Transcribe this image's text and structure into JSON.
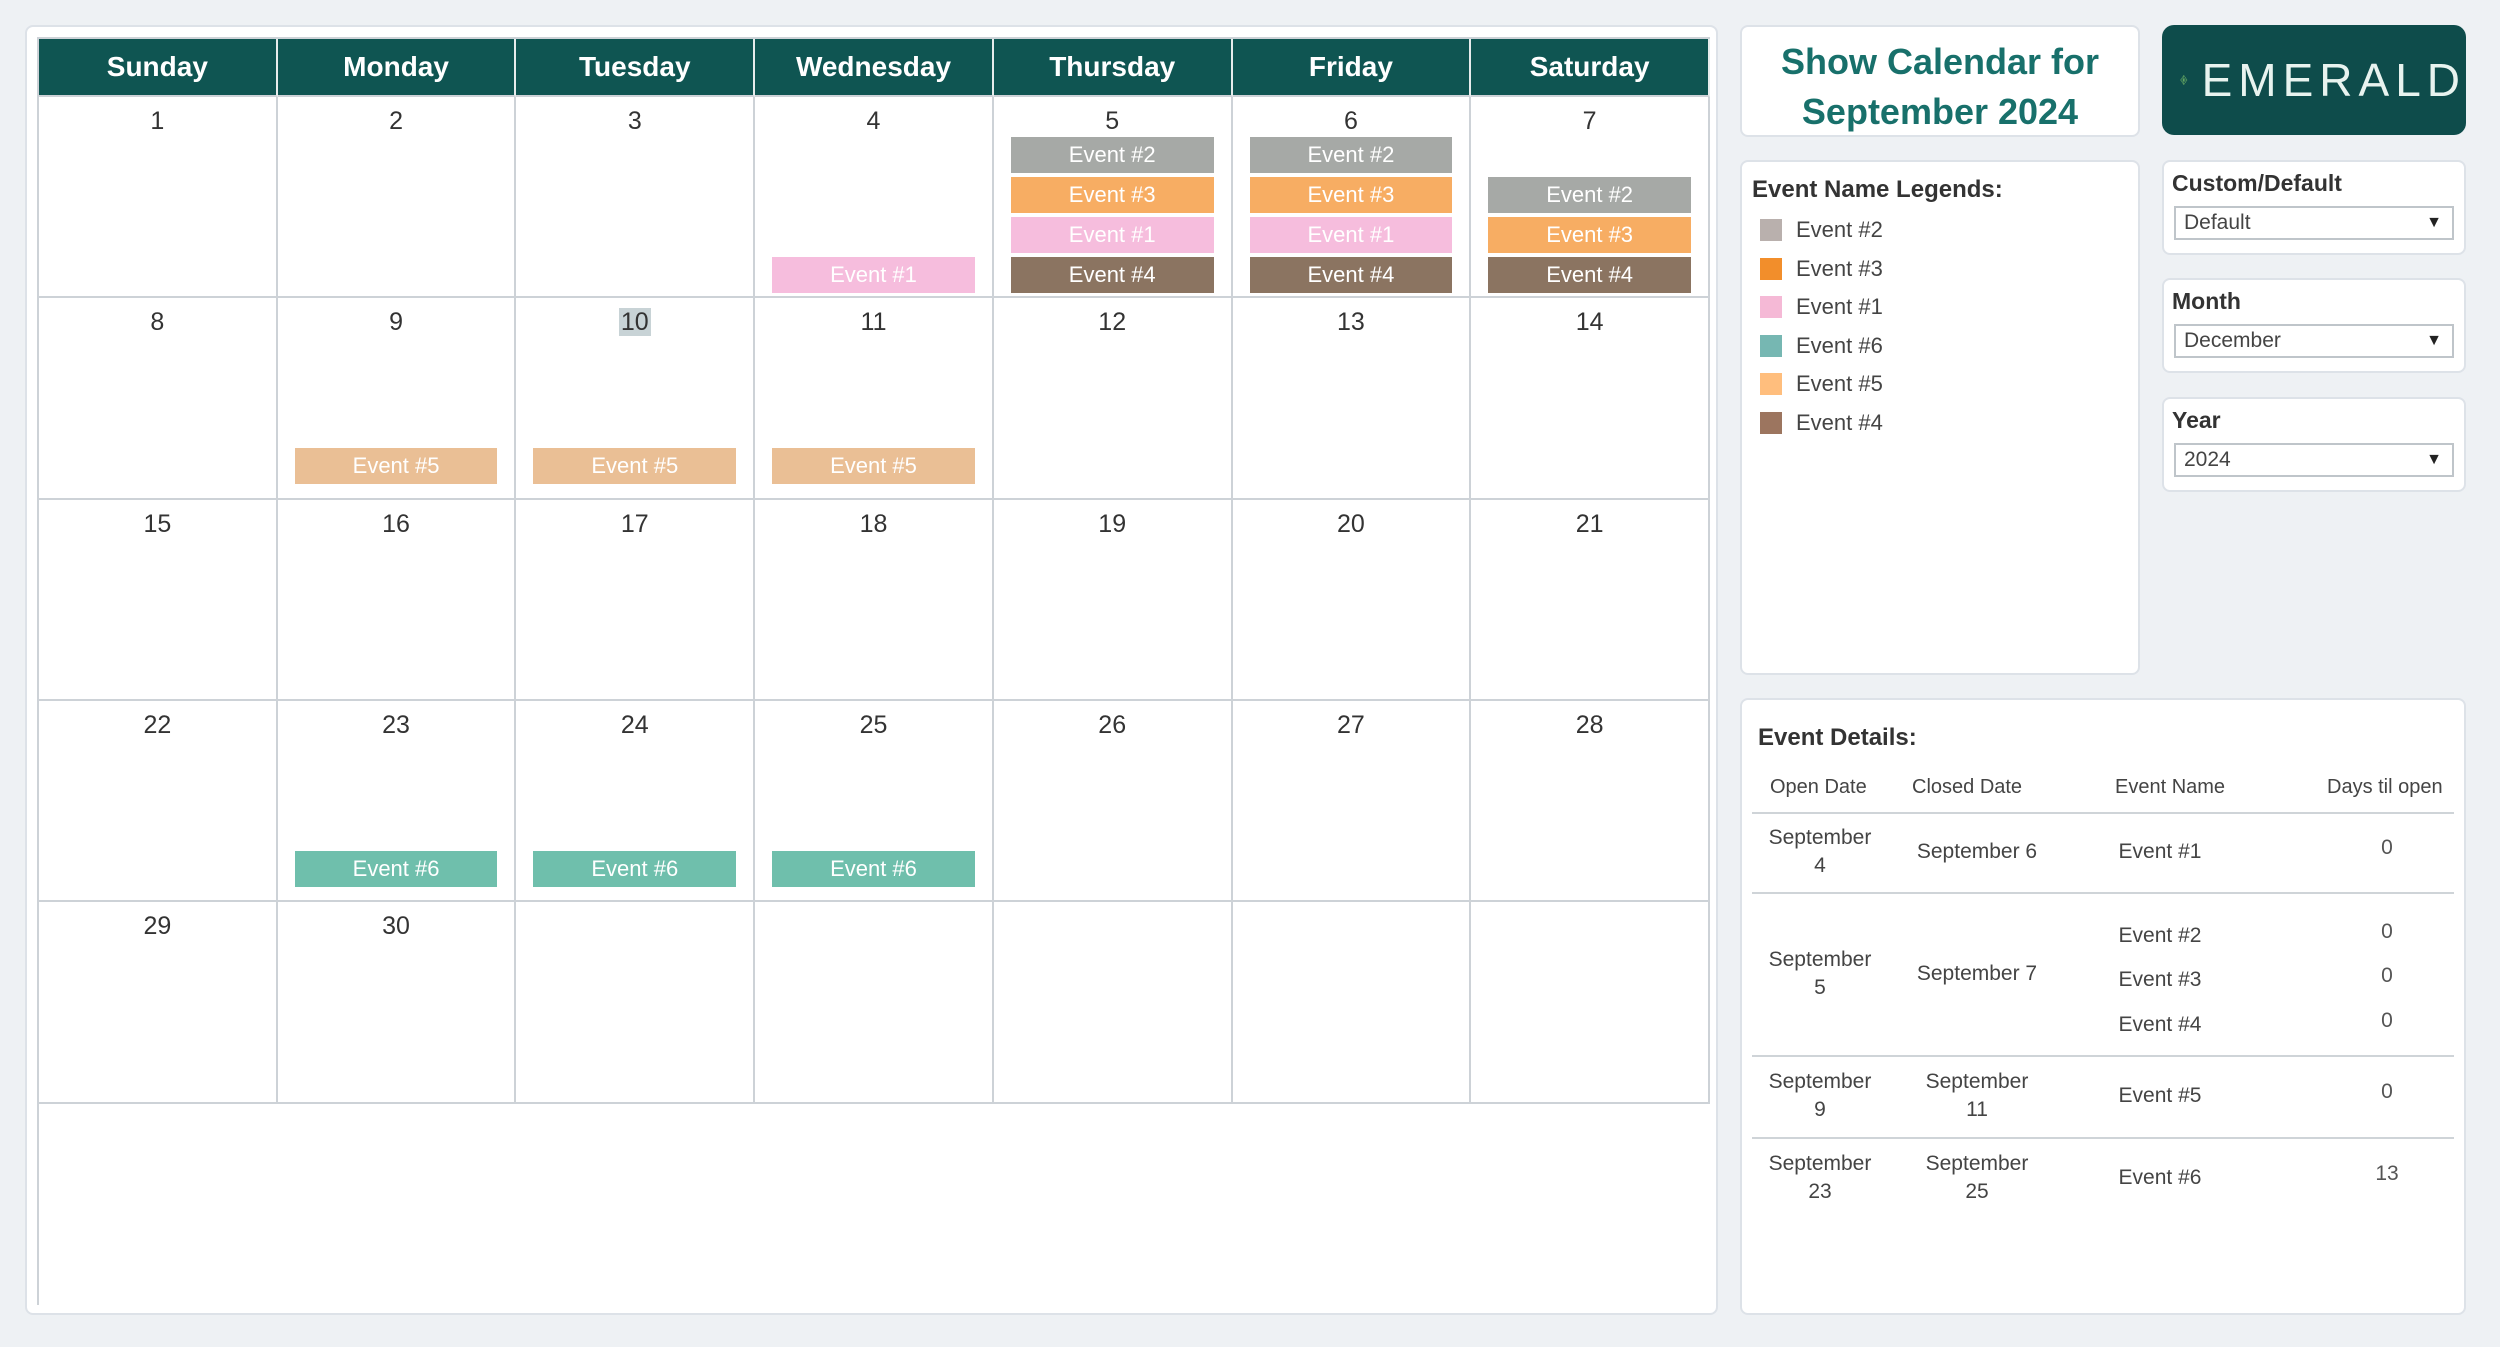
{
  "calendar": {
    "day_names": [
      "Sunday",
      "Monday",
      "Tuesday",
      "Wednesday",
      "Thursday",
      "Friday",
      "Saturday"
    ],
    "weeks": [
      [
        {
          "day": "1",
          "events": []
        },
        {
          "day": "2",
          "events": []
        },
        {
          "day": "3",
          "events": []
        },
        {
          "day": "4",
          "events": [
            {
              "name": "Event #1",
              "slot": 3
            }
          ]
        },
        {
          "day": "5",
          "events": [
            {
              "name": "Event #2",
              "slot": 0
            },
            {
              "name": "Event #3",
              "slot": 1
            },
            {
              "name": "Event #1",
              "slot": 2
            },
            {
              "name": "Event #4",
              "slot": 3
            }
          ]
        },
        {
          "day": "6",
          "events": [
            {
              "name": "Event #2",
              "slot": 0
            },
            {
              "name": "Event #3",
              "slot": 1
            },
            {
              "name": "Event #1",
              "slot": 2
            },
            {
              "name": "Event #4",
              "slot": 3
            }
          ]
        },
        {
          "day": "7",
          "events": [
            {
              "name": "Event #2",
              "slot": 1
            },
            {
              "name": "Event #3",
              "slot": 2
            },
            {
              "name": "Event #4",
              "slot": 3
            }
          ]
        }
      ],
      [
        {
          "day": "8",
          "events": []
        },
        {
          "day": "9",
          "events": [
            {
              "name": "Event #5",
              "slot": "mid"
            }
          ]
        },
        {
          "day": "10",
          "today": true,
          "events": [
            {
              "name": "Event #5",
              "slot": "mid"
            }
          ]
        },
        {
          "day": "11",
          "events": [
            {
              "name": "Event #5",
              "slot": "mid"
            }
          ]
        },
        {
          "day": "12",
          "events": []
        },
        {
          "day": "13",
          "events": []
        },
        {
          "day": "14",
          "events": []
        }
      ],
      [
        {
          "day": "15",
          "events": []
        },
        {
          "day": "16",
          "events": []
        },
        {
          "day": "17",
          "events": []
        },
        {
          "day": "18",
          "events": []
        },
        {
          "day": "19",
          "events": []
        },
        {
          "day": "20",
          "events": []
        },
        {
          "day": "21",
          "events": []
        }
      ],
      [
        {
          "day": "22",
          "events": []
        },
        {
          "day": "23",
          "events": [
            {
              "name": "Event #6",
              "slot": "mid"
            }
          ]
        },
        {
          "day": "24",
          "events": [
            {
              "name": "Event #6",
              "slot": "mid"
            }
          ]
        },
        {
          "day": "25",
          "events": [
            {
              "name": "Event #6",
              "slot": "mid"
            }
          ]
        },
        {
          "day": "26",
          "events": []
        },
        {
          "day": "27",
          "events": []
        },
        {
          "day": "28",
          "events": []
        }
      ],
      [
        {
          "day": "29",
          "events": []
        },
        {
          "day": "30",
          "events": []
        },
        {
          "day": "",
          "events": []
        },
        {
          "day": "",
          "events": []
        },
        {
          "day": "",
          "events": []
        },
        {
          "day": "",
          "events": []
        },
        {
          "day": "",
          "events": []
        }
      ]
    ]
  },
  "event_colors": {
    "Event #1": "#f6bddd",
    "Event #2": "#a6a9a6",
    "Event #3": "#f7ad63",
    "Event #4": "#8b7461",
    "Event #5": "#eabf95",
    "Event #6": "#6fbfac"
  },
  "title": {
    "line1": "Show Calendar for",
    "line2": "September 2024"
  },
  "logo": {
    "text": "EMERALD"
  },
  "legend": {
    "title": "Event Name Legends:",
    "items": [
      {
        "label": "Event #2",
        "color": "#b9b0ad"
      },
      {
        "label": "Event #3",
        "color": "#f28e2b"
      },
      {
        "label": "Event #1",
        "color": "#f5b9d6"
      },
      {
        "label": "Event #6",
        "color": "#76b7b2"
      },
      {
        "label": "Event #5",
        "color": "#ffbe7d"
      },
      {
        "label": "Event #4",
        "color": "#9c755f"
      }
    ]
  },
  "filters": {
    "custom": {
      "label": "Custom/Default",
      "value": "Default"
    },
    "month": {
      "label": "Month",
      "value": "December"
    },
    "year": {
      "label": "Year",
      "value": "2024"
    }
  },
  "details": {
    "title": "Event Details:",
    "columns": [
      "Open Date",
      "Closed Date",
      "Event Name",
      "Days til open"
    ],
    "groups": [
      {
        "open": [
          "September",
          "4"
        ],
        "closed": [
          "September 6"
        ],
        "events": [
          {
            "name": "Event #1",
            "days": "0"
          }
        ]
      },
      {
        "open": [
          "September",
          "5"
        ],
        "closed": [
          "September 7"
        ],
        "events": [
          {
            "name": "Event #2",
            "days": "0"
          },
          {
            "name": "Event #3",
            "days": "0"
          },
          {
            "name": "Event #4",
            "days": "0"
          }
        ]
      },
      {
        "open": [
          "September",
          "9"
        ],
        "closed": [
          "September",
          "11"
        ],
        "events": [
          {
            "name": "Event #5",
            "days": "0"
          }
        ]
      },
      {
        "open": [
          "September",
          "23"
        ],
        "closed": [
          "September",
          "25"
        ],
        "events": [
          {
            "name": "Event #6",
            "days": "13"
          }
        ]
      }
    ]
  }
}
